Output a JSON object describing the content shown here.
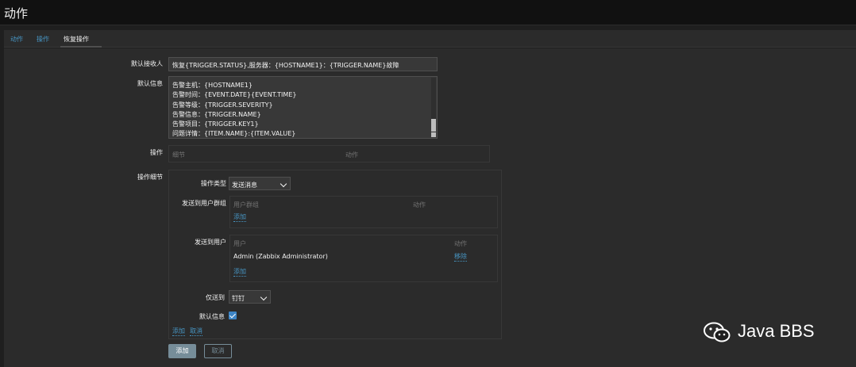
{
  "header": {
    "title": "动作"
  },
  "tabs": [
    {
      "label": "动作"
    },
    {
      "label": "操作"
    },
    {
      "label": "恢复操作"
    }
  ],
  "form": {
    "default_recipient_label": "默认接收人",
    "default_recipient_value": "恢复{TRIGGER.STATUS},服务器：{HOSTNAME1}：{TRIGGER.NAME}故障",
    "default_message_label": "默认信息",
    "default_message_lines": [
      "告警主机：{HOSTNAME1}",
      "告警时间：{EVENT.DATE}{EVENT.TIME}",
      "告警等级：{TRIGGER.SEVERITY}",
      "告警信息：{TRIGGER.NAME}",
      "告警项目：{TRIGGER.KEY1}",
      "问题详情：{ITEM.NAME}:{ITEM.VALUE}"
    ],
    "operations_label": "操作",
    "operations_col_details": "细节",
    "operations_col_action": "动作",
    "op_details_label": "操作细节",
    "op_type_label": "操作类型",
    "op_type_value": "发送消息",
    "send_groups_label": "发送到用户群组",
    "groups_col_group": "用户群组",
    "groups_col_action": "动作",
    "groups_add": "添加",
    "send_users_label": "发送到用户",
    "users_col_user": "用户",
    "users_col_action": "动作",
    "user_row_name": "Admin (Zabbix Administrator)",
    "user_row_remove": "移除",
    "users_add": "添加",
    "send_only_label": "仅送到",
    "send_only_value": "钉钉",
    "default_msg_check_label": "默认信息",
    "default_msg_checked": true,
    "inline_add": "添加",
    "inline_cancel": "取消",
    "add_button": "添加",
    "cancel_button": "取消"
  },
  "watermark": {
    "text": "Java BBS"
  },
  "colors": {
    "link": "#4796c4",
    "primary_button": "#768d99",
    "checkbox": "#3d85c6"
  }
}
